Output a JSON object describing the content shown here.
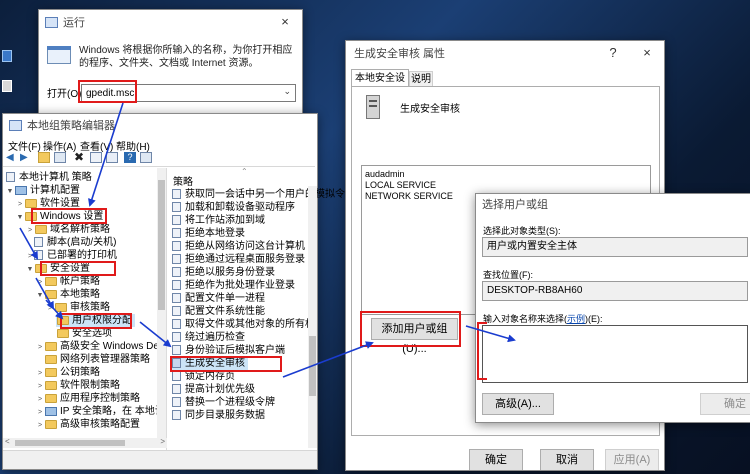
{
  "run": {
    "title": "运行",
    "description": "Windows 将根据你所输入的名称，为你打开相应的程序、文件夹、文档或 Internet 资源。",
    "open_label": "打开(O):",
    "command": "gpedit.msc"
  },
  "gpedit": {
    "title": "本地组策略编辑器",
    "menu": [
      "文件(F)",
      "操作(A)",
      "查看(V)",
      "帮助(H)"
    ],
    "tree": [
      {
        "label": "本地计算机 策略"
      },
      {
        "label": "计算机配置"
      },
      {
        "label": "软件设置"
      },
      {
        "label": "Windows 设置"
      },
      {
        "label": "域名解析策略"
      },
      {
        "label": "脚本(启动/关机)"
      },
      {
        "label": "已部署的打印机"
      },
      {
        "label": "安全设置"
      },
      {
        "label": "帐户策略"
      },
      {
        "label": "本地策略"
      },
      {
        "label": "审核策略"
      },
      {
        "label": "用户权限分配"
      },
      {
        "label": "安全选项"
      },
      {
        "label": "高级安全 Windows Def"
      },
      {
        "label": "网络列表管理器策略"
      },
      {
        "label": "公钥策略"
      },
      {
        "label": "软件限制策略"
      },
      {
        "label": "应用程序控制策略"
      },
      {
        "label": "IP 安全策略，在 本地计"
      },
      {
        "label": "高级审核策略配置"
      }
    ],
    "policy_header": "策略",
    "policies": [
      "获取同一会话中另一个用户的模拟令牌",
      "加载和卸载设备驱动程序",
      "将工作站添加到域",
      "拒绝本地登录",
      "拒绝从网络访问这台计算机",
      "拒绝通过远程桌面服务登录",
      "拒绝以服务身份登录",
      "拒绝作为批处理作业登录",
      "配置文件单一进程",
      "配置文件系统性能",
      "取得文件或其他对象的所有权",
      "绕过遍历检查",
      "身份验证后模拟客户端",
      "生成安全审核",
      "锁定内存页",
      "提高计划优先级",
      "替换一个进程级令牌",
      "同步目录服务数据"
    ]
  },
  "props": {
    "title": "生成安全审核 属性",
    "tabs": [
      "本地安全设置",
      "说明"
    ],
    "policy_name": "生成安全审核",
    "accounts": [
      "audadmin",
      "LOCAL SERVICE",
      "NETWORK SERVICE"
    ],
    "add_button": "添加用户或组(U)...",
    "ok": "确定",
    "cancel": "取消",
    "apply": "应用(A)"
  },
  "select": {
    "title": "选择用户或组",
    "object_type_label": "选择此对象类型(S):",
    "object_type_value": "用户或内置安全主体",
    "location_label": "查找位置(F):",
    "location_value": "DESKTOP-RB8AH60",
    "enter_label_prefix": "输入对象名称来选择(",
    "enter_label_link": "示例",
    "enter_label_suffix": ")(E):",
    "advanced": "高级(A)...",
    "ok": "确定"
  },
  "colors": {
    "highlight": "#e01a1a",
    "arrow": "#1a3ccf",
    "selection": "#cce4f7"
  }
}
